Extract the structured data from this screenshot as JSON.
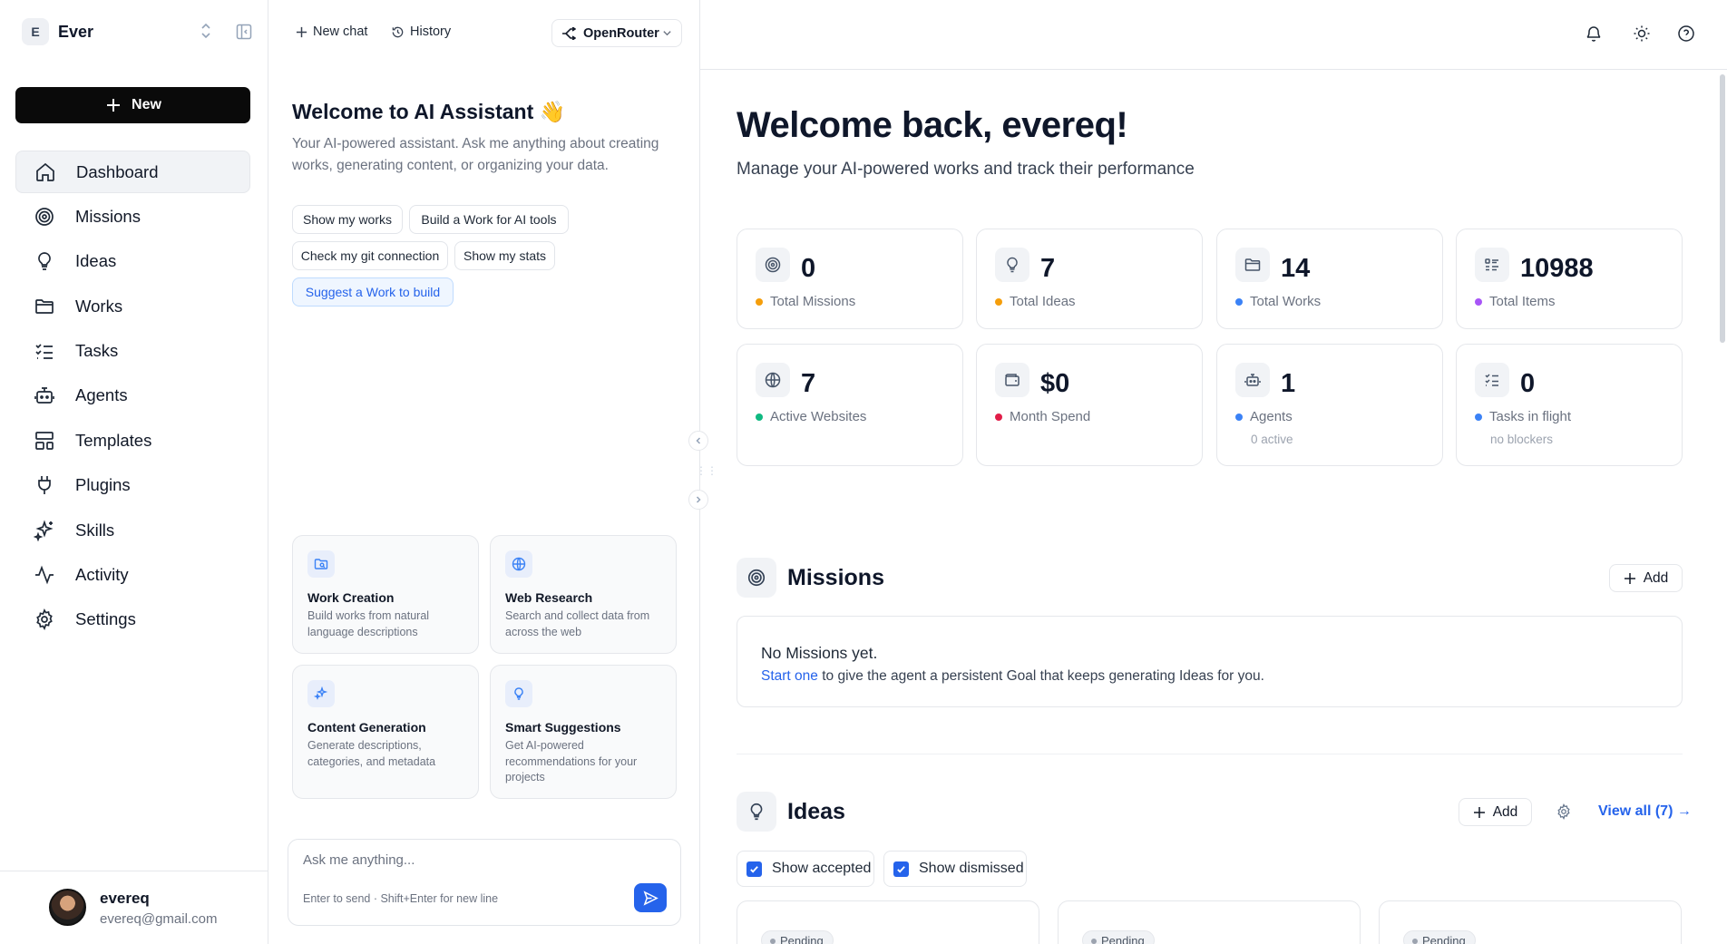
{
  "sidebar": {
    "workspace": {
      "initial": "E",
      "name": "Ever"
    },
    "new_label": "New",
    "items": [
      {
        "label": "Dashboard",
        "icon": "home-icon",
        "active": true
      },
      {
        "label": "Missions",
        "icon": "target-icon"
      },
      {
        "label": "Ideas",
        "icon": "lightbulb-icon"
      },
      {
        "label": "Works",
        "icon": "folder-icon"
      },
      {
        "label": "Tasks",
        "icon": "checklist-icon"
      },
      {
        "label": "Agents",
        "icon": "bot-icon"
      },
      {
        "label": "Templates",
        "icon": "layout-icon"
      },
      {
        "label": "Plugins",
        "icon": "plug-icon"
      },
      {
        "label": "Skills",
        "icon": "sparkles-icon"
      },
      {
        "label": "Activity",
        "icon": "activity-icon"
      },
      {
        "label": "Settings",
        "icon": "gear-icon"
      }
    ],
    "user": {
      "name": "evereq",
      "email": "evereq@gmail.com"
    }
  },
  "chat": {
    "new_chat": "New chat",
    "history": "History",
    "provider": "OpenRouter",
    "title": "Welcome to AI Assistant 👋",
    "subtitle": "Your AI-powered assistant. Ask me anything about creating works, generating content, or organizing your data.",
    "chips": [
      "Show my works",
      "Build a Work for AI tools",
      "Check my git connection",
      "Show my stats",
      "Suggest a Work to build"
    ],
    "features": [
      {
        "title": "Work Creation",
        "desc": "Build works from natural language descriptions",
        "icon": "folder-search-icon"
      },
      {
        "title": "Web Research",
        "desc": "Search and collect data from across the web",
        "icon": "globe-icon"
      },
      {
        "title": "Content Generation",
        "desc": "Generate descriptions, categories, and metadata",
        "icon": "sparkles-icon"
      },
      {
        "title": "Smart Suggestions",
        "desc": "Get AI-powered recommendations for your projects",
        "icon": "lightbulb-icon"
      }
    ],
    "input_placeholder": "Ask me anything...",
    "input_hint": "Enter to send · Shift+Enter for new line"
  },
  "main": {
    "title": "Welcome back, evereq!",
    "subtitle": "Manage your AI-powered works and track their performance",
    "stats": [
      {
        "value": "0",
        "label": "Total Missions",
        "dot": "#f59e0b",
        "icon": "target-icon"
      },
      {
        "value": "7",
        "label": "Total Ideas",
        "dot": "#f59e0b",
        "icon": "lightbulb-icon"
      },
      {
        "value": "14",
        "label": "Total Works",
        "dot": "#3b82f6",
        "icon": "folder-icon"
      },
      {
        "value": "10988",
        "label": "Total Items",
        "dot": "#a855f7",
        "icon": "list-icon"
      },
      {
        "value": "7",
        "label": "Active Websites",
        "dot": "#10b981",
        "icon": "globe-icon"
      },
      {
        "value": "$0",
        "label": "Month Spend",
        "dot": "#e11d48",
        "icon": "wallet-icon"
      },
      {
        "value": "1",
        "label": "Agents",
        "sub": "0 active",
        "dot": "#3b82f6",
        "icon": "bot-icon"
      },
      {
        "value": "0",
        "label": "Tasks in flight",
        "sub": "no blockers",
        "dot": "#3b82f6",
        "icon": "checklist-icon"
      }
    ],
    "missions": {
      "title": "Missions",
      "add": "Add",
      "empty_title": "No Missions yet.",
      "empty_link": "Start one",
      "empty_rest": " to give the agent a persistent Goal that keeps generating Ideas for you."
    },
    "ideas": {
      "title": "Ideas",
      "add": "Add",
      "view_all": "View all (7) →",
      "show_accepted": "Show accepted",
      "show_dismissed": "Show dismissed",
      "cards": [
        {
          "status": "Pending"
        },
        {
          "status": "Pending"
        },
        {
          "status": "Pending"
        }
      ]
    }
  },
  "colors": {
    "accent": "#2563eb",
    "primary_button": "#0a0a0a"
  }
}
